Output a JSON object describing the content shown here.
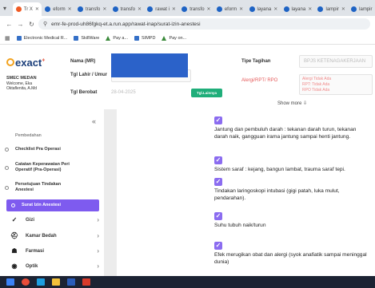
{
  "browser": {
    "tabs": [
      {
        "label": "Tr X",
        "active": true
      },
      {
        "label": "eform"
      },
      {
        "label": "transfo"
      },
      {
        "label": "transfo"
      },
      {
        "label": "rawat i"
      },
      {
        "label": "transfo"
      },
      {
        "label": "eform"
      },
      {
        "label": "layana"
      },
      {
        "label": "layana"
      },
      {
        "label": "lampir"
      },
      {
        "label": "lampir"
      }
    ],
    "url": "emr-fe-prod-uh86fgkq-et.a.run.app/rawat-inap/surat-izin-anestesi",
    "bookmarks": [
      {
        "label": "Electronic Medical R..."
      },
      {
        "label": "SkillWare"
      },
      {
        "label": "Pay a..."
      },
      {
        "label": "SIMPD"
      },
      {
        "label": "Pay on..."
      }
    ]
  },
  "header": {
    "brand": "exact",
    "brand_mark": "+",
    "site": "SMEC MEDAN",
    "welcome_line1": "Welcome, Eka",
    "welcome_line2": "Oktaflenita, A.Md",
    "label_name": "Nama (MR)",
    "label_dob": "Tgl Lahir / Umur",
    "label_visit": "Tgl Berobat",
    "visit_date": "28-04-2025",
    "btn_lainnya": "Tgl.Lainnya",
    "label_payer": "Tipe Tagihan",
    "payer": "BPJS KETENAGAKERJAAN",
    "label_allergy": "Alergi/RPT/ RPO",
    "allergy": "Alergi Tidak Ada",
    "rpt": "RPT: Tidak Ada",
    "rpo": "RPO Tidak Ada",
    "show_more": "Show more ⇩"
  },
  "sidebar": {
    "collapse_glyph": "«",
    "sub_items": [
      {
        "label": "Pembedahan"
      },
      {
        "label": "Checklist Pra Operasi"
      },
      {
        "label": "Catatan Keperawatan Peri Operatif (Pra-Operasi)"
      },
      {
        "label": "Persetujuan Tindakan Anestesi"
      },
      {
        "label": "Surat Izin Anestesi",
        "active": true
      }
    ],
    "menus": [
      {
        "label": "Gizi"
      },
      {
        "label": "Kamar Bedah"
      },
      {
        "label": "Farmasi"
      },
      {
        "label": "Optik"
      }
    ]
  },
  "content": {
    "items": [
      {
        "text": "Jantung dan pembuluh darah : tekanan darah turun, tekanan darah naik, gangguan irama jantung sampai henti jantung."
      },
      {
        "text": "Sistem saraf : kejang, bangun lambat, trauma saraf tepi."
      },
      {
        "text": "Tindakan laringoskopi intubasi (gigi patah, luka mulut, pendarahan)."
      },
      {
        "text": "Suhu tubuh naik/turun"
      },
      {
        "text": "Efek merugikan obat dan alergi (syok anafiatik sampai meninggal dunia)"
      }
    ]
  },
  "colors": {
    "accent": "#7e5bef",
    "checkbox": "#8b6cf0",
    "button_green": "#1fae7a",
    "redaction": "#2b62c9"
  }
}
